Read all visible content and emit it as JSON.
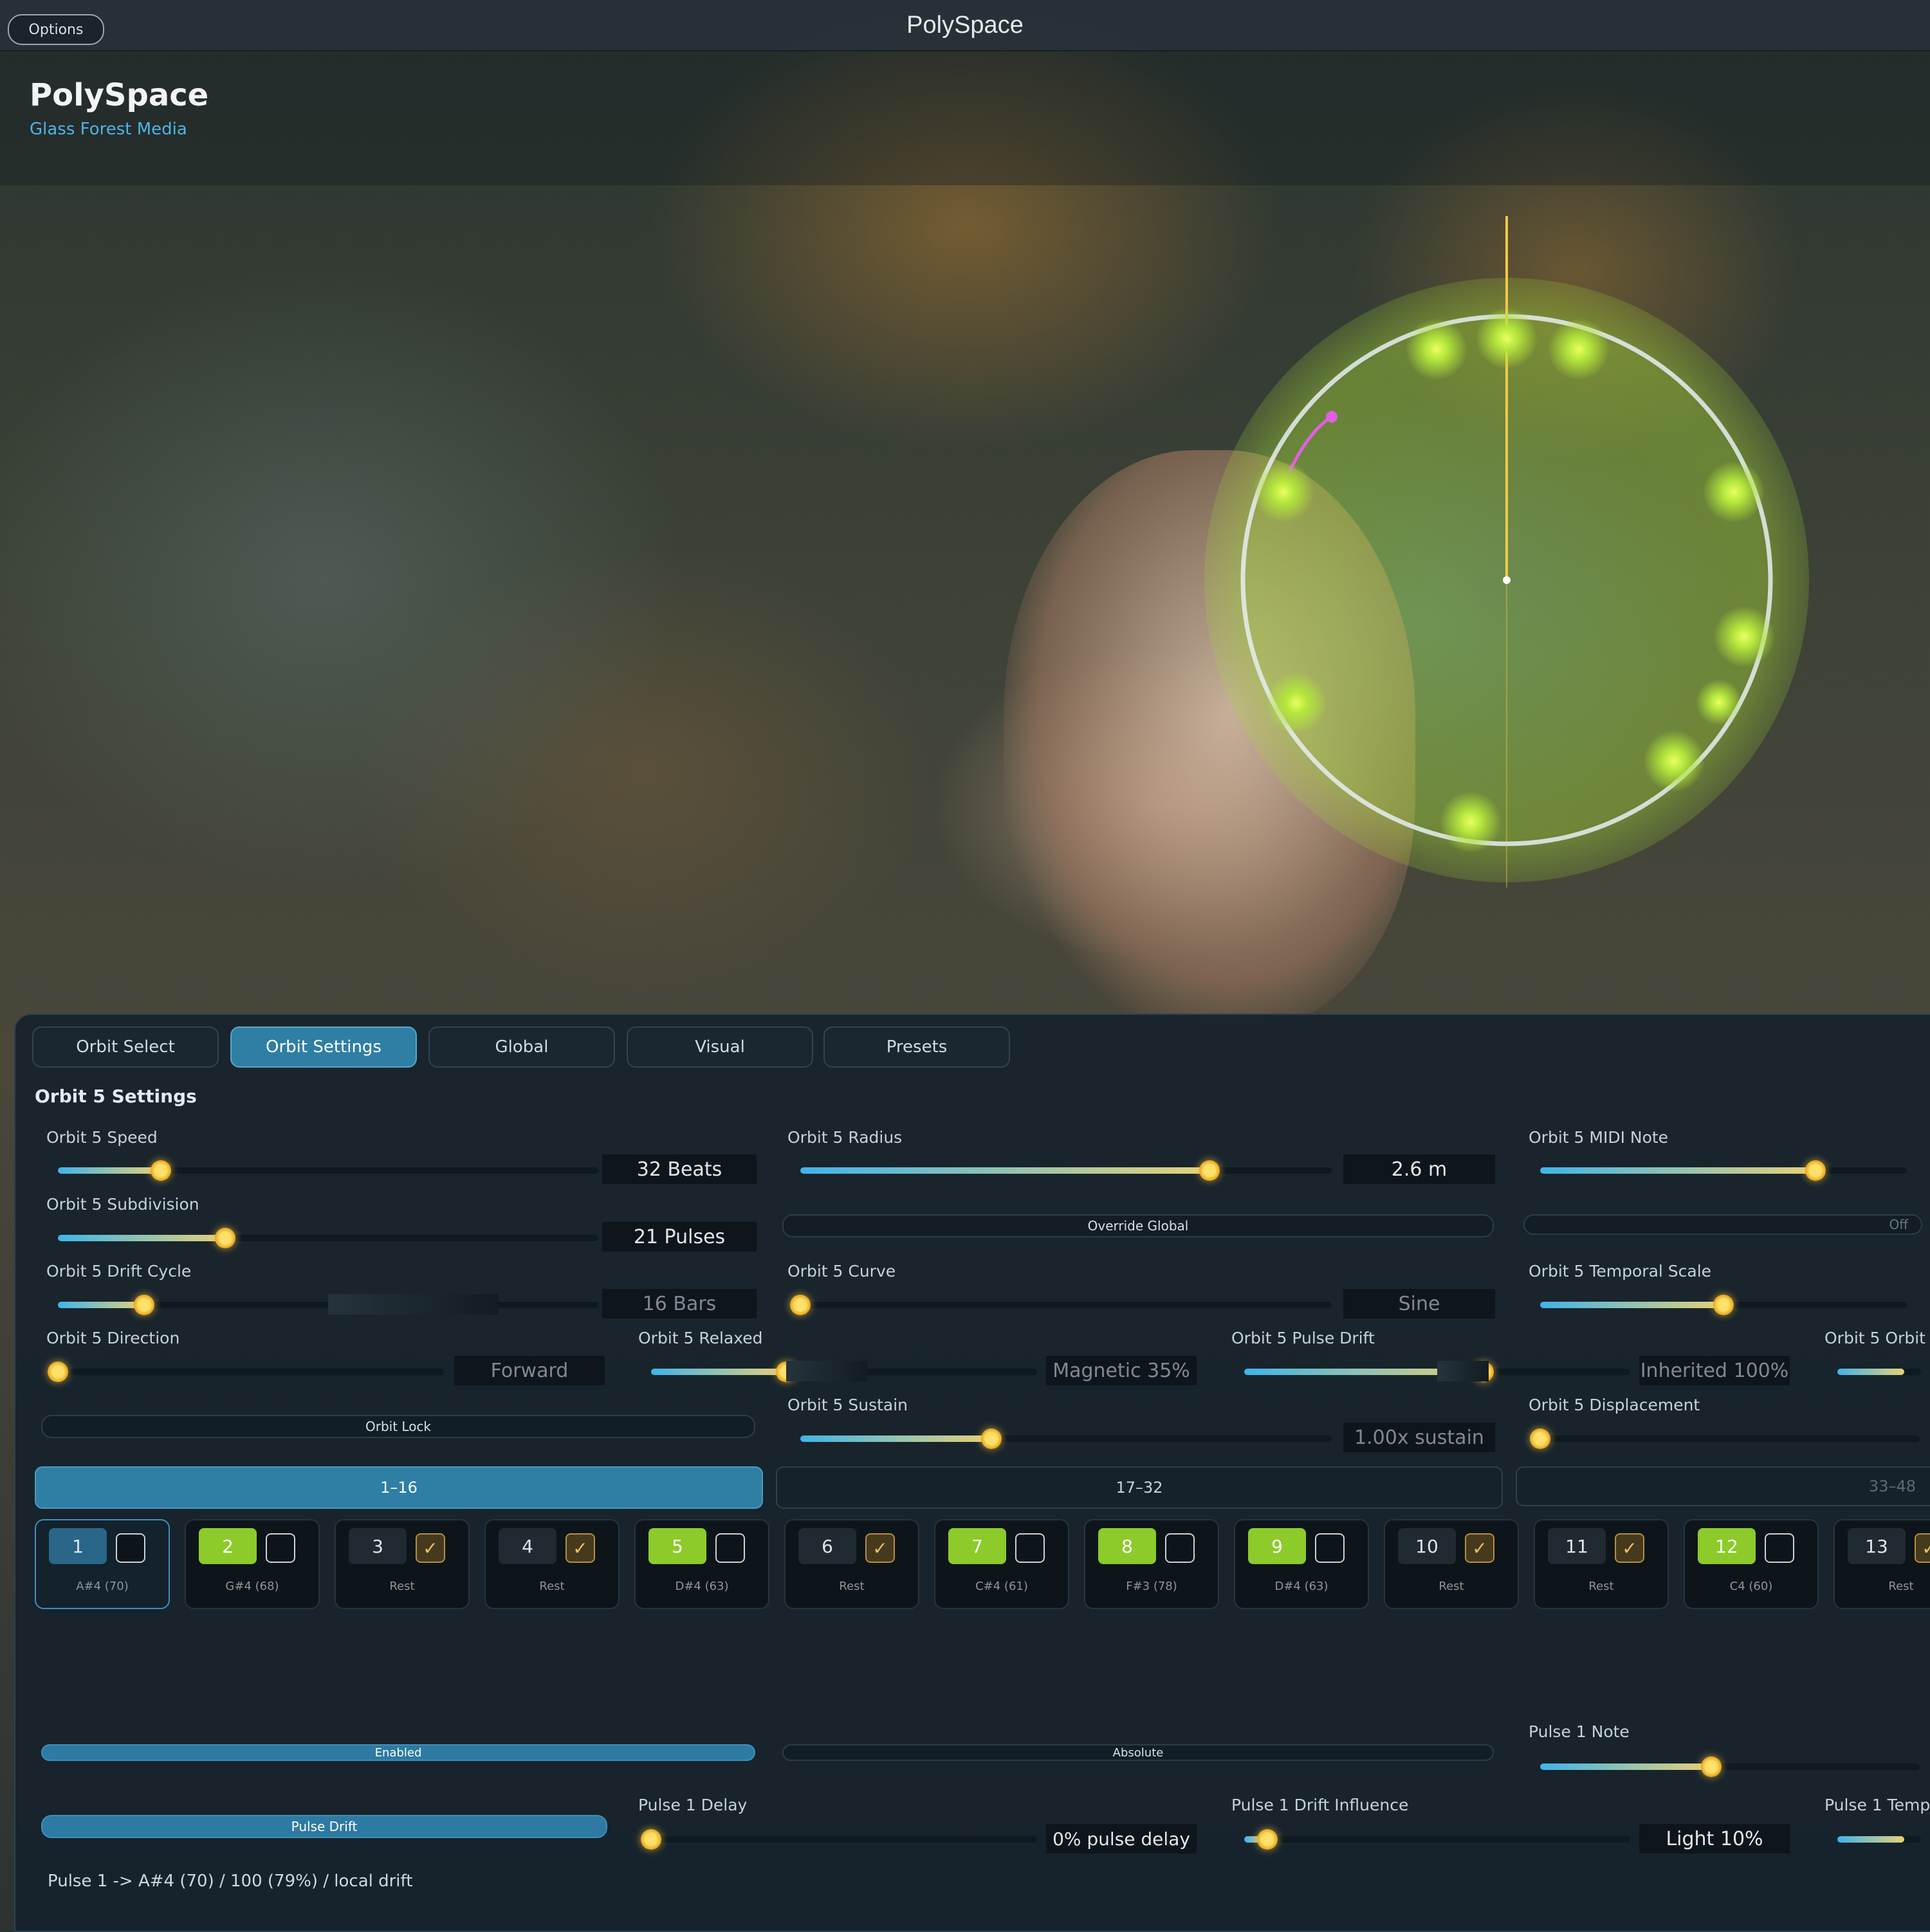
{
  "window": {
    "title": "PolySpace",
    "options_label": "Options"
  },
  "app": {
    "title": "PolySpace",
    "subtitle": "Glass Forest Media"
  },
  "tabs": [
    {
      "label": "Orbit Select",
      "active": false
    },
    {
      "label": "Orbit Settings",
      "active": true
    },
    {
      "label": "Global",
      "active": false
    },
    {
      "label": "Visual",
      "active": false
    },
    {
      "label": "Presets",
      "active": false
    }
  ],
  "section_title": "Orbit 5 Settings",
  "sliders": {
    "speed": {
      "label": "Orbit 5 Speed",
      "value": "32 Beats",
      "level": 0.19
    },
    "radius": {
      "label": "Orbit 5 Radius",
      "value": "2.6 m",
      "level": 0.77
    },
    "midi_note": {
      "label": "Orbit 5 MIDI Note",
      "level": 0.75
    },
    "subdivision": {
      "label": "Orbit 5 Subdivision",
      "value": "21 Pulses",
      "level": 0.31
    },
    "drift_cycle": {
      "label": "Orbit 5 Drift Cycle",
      "value": "16 Bars",
      "level": 0.16
    },
    "curve": {
      "label": "Orbit 5 Curve",
      "value": "Sine",
      "level": 0.0
    },
    "temporal_scale": {
      "label": "Orbit 5 Temporal Scale",
      "level": 0.5
    },
    "direction": {
      "label": "Orbit 5 Direction",
      "value": "Forward",
      "level": 0.0
    },
    "relaxed": {
      "label": "Orbit 5 Relaxed",
      "value": "Magnetic 35%",
      "level": 0.35
    },
    "pulse_drift": {
      "label": "Orbit 5 Pulse Drift",
      "value": "Inherited 100%",
      "level": 0.62
    },
    "orbit_extra": {
      "label": "Orbit 5 Orbit",
      "level": 0.8
    },
    "sustain": {
      "label": "Orbit 5 Sustain",
      "value": "1.00x sustain",
      "level": 0.36
    },
    "displacement": {
      "label": "Orbit 5 Displacement",
      "level": 0.0
    }
  },
  "buttons": {
    "override_global": "Override Global",
    "midi_disabled": "Off",
    "orbit_lock": "Orbit Lock",
    "enabled": "Enabled",
    "absolute": "Absolute",
    "pulse_drift": "Pulse Drift"
  },
  "ranges": [
    {
      "label": "1–16",
      "active": true
    },
    {
      "label": "17–32",
      "active": false
    },
    {
      "label": "33–48",
      "active": false
    }
  ],
  "pulses": [
    {
      "num": "1",
      "active": false,
      "selected": true,
      "checked": false,
      "note": "A#4 (70)"
    },
    {
      "num": "2",
      "active": true,
      "selected": false,
      "checked": false,
      "note": "G#4 (68)"
    },
    {
      "num": "3",
      "active": false,
      "selected": false,
      "checked": true,
      "note": "Rest"
    },
    {
      "num": "4",
      "active": false,
      "selected": false,
      "checked": true,
      "note": "Rest"
    },
    {
      "num": "5",
      "active": true,
      "selected": false,
      "checked": false,
      "note": "D#4 (63)"
    },
    {
      "num": "6",
      "active": false,
      "selected": false,
      "checked": true,
      "note": "Rest"
    },
    {
      "num": "7",
      "active": true,
      "selected": false,
      "checked": false,
      "note": "C#4 (61)"
    },
    {
      "num": "8",
      "active": true,
      "selected": false,
      "checked": false,
      "note": "F#3 (78)"
    },
    {
      "num": "9",
      "active": true,
      "selected": false,
      "checked": false,
      "note": "D#4 (63)"
    },
    {
      "num": "10",
      "active": false,
      "selected": false,
      "checked": true,
      "note": "Rest"
    },
    {
      "num": "11",
      "active": false,
      "selected": false,
      "checked": true,
      "note": "Rest"
    },
    {
      "num": "12",
      "active": true,
      "selected": false,
      "checked": false,
      "note": "C4 (60)"
    },
    {
      "num": "13",
      "active": false,
      "selected": false,
      "checked": true,
      "note": "Rest"
    }
  ],
  "pulse_settings": {
    "note": {
      "label": "Pulse 1 Note",
      "level": 0.45
    },
    "delay": {
      "label": "Pulse 1 Delay",
      "value": "0% pulse delay",
      "level": 0.0
    },
    "drift_influence": {
      "label": "Pulse 1 Drift Influence",
      "value": "Light 10%",
      "level": 0.06
    },
    "temp": {
      "label": "Pulse 1 Temp",
      "level": 0.8
    }
  },
  "footer": "Pulse 1 -> A#4 (70) / 100 (79%) / local drift",
  "colors": {
    "accent": "#2f7ea4",
    "active_pulse": "#8ccb2a",
    "knob": "#f0b62c",
    "orbit": "#b4e63c",
    "marker": "#e060e0"
  }
}
